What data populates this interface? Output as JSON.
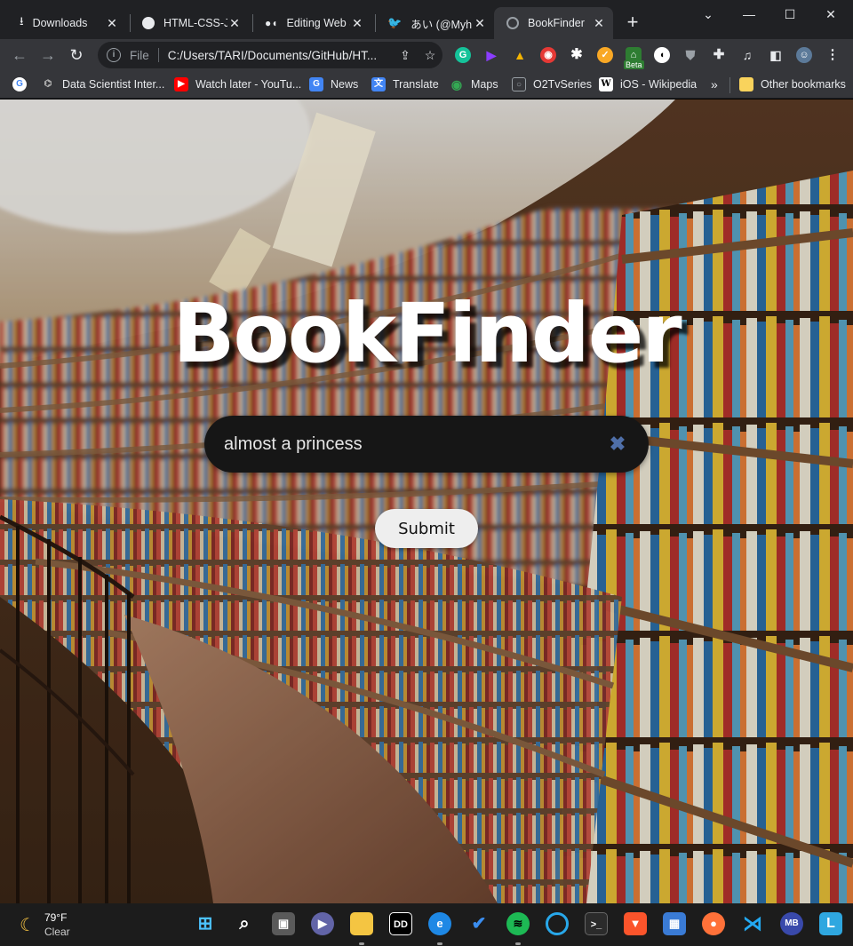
{
  "browser": {
    "tabs": [
      {
        "title": "Downloads",
        "icon": "download-icon",
        "active": false
      },
      {
        "title": "HTML-CSS-JA",
        "icon": "github-icon",
        "active": false
      },
      {
        "title": "Editing Web S",
        "icon": "medium-icon",
        "active": false
      },
      {
        "title": "あい (@MyhnT",
        "icon": "twitter-icon",
        "active": false
      },
      {
        "title": "BookFinder",
        "icon": "globe-icon",
        "active": true
      }
    ],
    "new_tab_label": "+",
    "window_controls": {
      "minimize": "⌄",
      "restore": "—",
      "maximize": "☐",
      "close": "✕"
    },
    "address": {
      "scheme": "File",
      "url": "C:/Users/TARI/Documents/GitHub/HT..."
    },
    "extension_badge": "Beta",
    "bookmarks": [
      {
        "label": "",
        "icon": "google-icon"
      },
      {
        "label": "Data Scientist Inter...",
        "icon": "bookmark-icon"
      },
      {
        "label": "Watch later - YouTu...",
        "icon": "youtube-icon"
      },
      {
        "label": "News",
        "icon": "news-icon"
      },
      {
        "label": "Translate",
        "icon": "translate-icon"
      },
      {
        "label": "Maps",
        "icon": "maps-icon"
      },
      {
        "label": "O2TvSeries",
        "icon": "site-icon"
      },
      {
        "label": "iOS - Wikipedia",
        "icon": "wikipedia-icon"
      }
    ],
    "bookmarks_more": "»",
    "other_bookmarks": "Other bookmarks"
  },
  "page": {
    "title": "BookFinder",
    "search": {
      "value": "almost a princess",
      "clear_symbol": "✖"
    },
    "submit_label": "Submit"
  },
  "taskbar": {
    "weather": {
      "temp": "79°F",
      "condition": "Clear"
    },
    "user_initials": "MB",
    "apps": [
      "start-icon",
      "search-icon",
      "task-view-icon",
      "chat-icon",
      "file-explorer-icon",
      "dolby-icon",
      "edge-icon",
      "todo-icon",
      "spotify-icon",
      "cortana-icon",
      "terminal-icon",
      "brave-icon",
      "store-icon",
      "firefox-icon",
      "vscode-icon",
      "account-icon",
      "app-l-icon"
    ]
  },
  "colors": {
    "search_bg": "#161616",
    "clear_icon": "#4f6fa8",
    "button_bg": "#eeeeee"
  }
}
